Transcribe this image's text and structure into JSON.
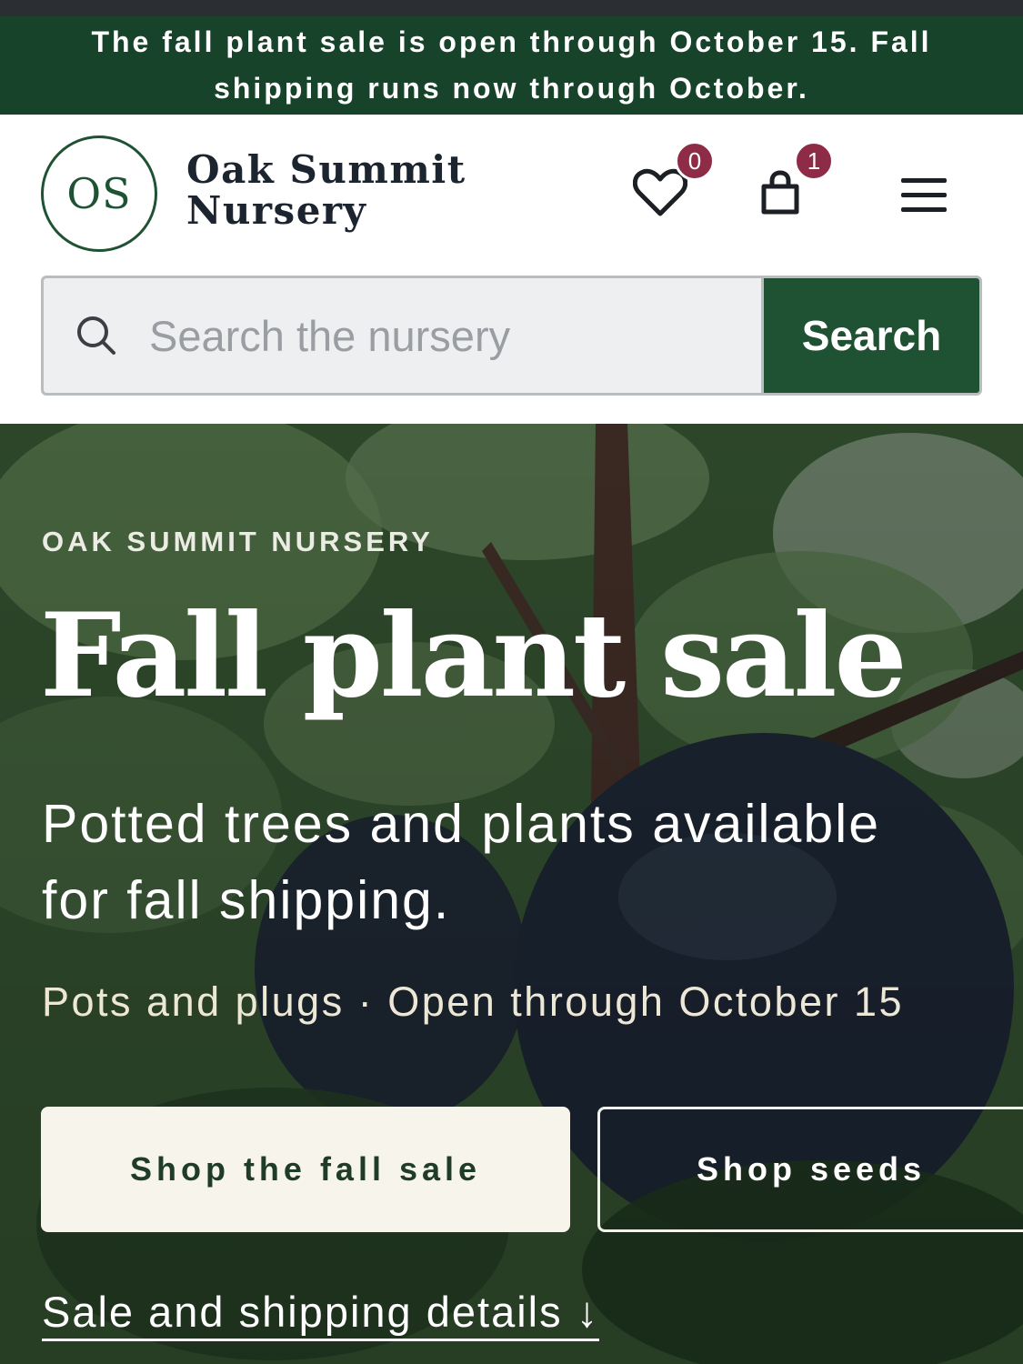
{
  "announcement": {
    "text": "The fall plant sale is open through October 15. Fall shipping runs now through October."
  },
  "brand": {
    "monogram": "OS",
    "name_line1": "Oak Summit",
    "name_line2": "Nursery",
    "accent_color": "#1e5233",
    "banner_color": "#17432b",
    "badge_color": "#8e2b47"
  },
  "header_icons": {
    "wishlist": {
      "icon": "heart-icon",
      "count": "0"
    },
    "cart": {
      "icon": "shopping-bag-icon",
      "count": "1"
    },
    "menu": {
      "icon": "hamburger-menu-icon"
    }
  },
  "search": {
    "placeholder": "Search the nursery",
    "value": "",
    "button_label": "Search",
    "icon": "search-icon"
  },
  "hero": {
    "eyebrow": "OAK SUMMIT NURSERY",
    "title": "Fall plant sale",
    "subtitle": "Potted trees and plants available for fall shipping.",
    "meta": "Pots and plugs · Open through October 15",
    "primary_cta": "Shop the fall sale",
    "secondary_cta": "Shop seeds",
    "details_link": "Sale and shipping details ↓"
  }
}
